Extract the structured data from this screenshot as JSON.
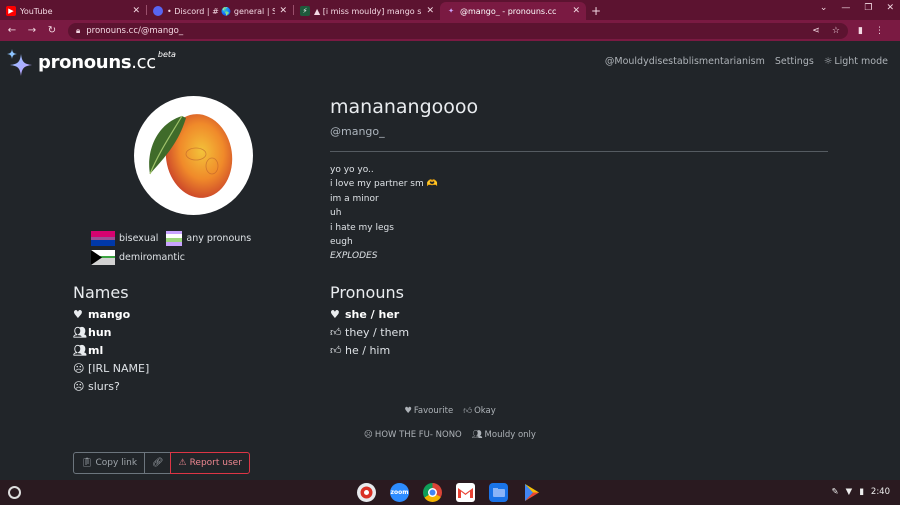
{
  "browser": {
    "tabs": [
      {
        "title": "YouTube",
        "icon": "youtube-icon",
        "color": "#ff0000",
        "active": false
      },
      {
        "title": "• Discord | # 🌎 general | Sou",
        "icon": "discord-icon",
        "color": "#5865f2",
        "active": false
      },
      {
        "title": "▲ [i miss mouldy] mango s",
        "icon": "tab-app-icon",
        "color": "#1e5a3c",
        "active": false
      },
      {
        "title": "@mango_ - pronouns.cc",
        "icon": "pronouns-icon",
        "color": "#b388ff",
        "active": true
      }
    ],
    "url": "pronouns.cc/@mango_"
  },
  "site": {
    "brand": "pronouns",
    "brand_tld": ".cc",
    "beta": "beta",
    "nav": {
      "user": "@Mouldydisestablismentarianism",
      "settings": "Settings",
      "theme": "Light mode"
    }
  },
  "profile": {
    "display_name": "mananangoooo",
    "username": "@mango_",
    "bio": [
      "yo yo yo..",
      "i love my partner sm 🫶",
      "im a minor",
      "uh",
      "i hate my legs",
      "eugh",
      "EXPLODES"
    ],
    "flags": [
      {
        "name": "bisexual"
      },
      {
        "name": "any pronouns"
      },
      {
        "name": "demiromantic"
      }
    ],
    "names_title": "Names",
    "names": [
      {
        "text": "mango",
        "icon": "heart-icon",
        "bold": true
      },
      {
        "text": "hun",
        "icon": "people-icon",
        "bold": true
      },
      {
        "text": "ml",
        "icon": "people-icon",
        "bold": true
      },
      {
        "text": "[IRL NAME]",
        "icon": "frown-icon",
        "bold": false
      },
      {
        "text": "slurs?",
        "icon": "frown-icon",
        "bold": false
      }
    ],
    "pronouns_title": "Pronouns",
    "pronouns": [
      {
        "text": "she / her",
        "icon": "heart-icon",
        "bold": true
      },
      {
        "text": "they / them",
        "icon": "thumbs-up-icon",
        "bold": false
      },
      {
        "text": "he / him",
        "icon": "thumbs-up-icon",
        "bold": false
      }
    ]
  },
  "legend": {
    "row1": [
      {
        "text": "Favourite",
        "icon": "heart-icon"
      },
      {
        "text": "Okay",
        "icon": "thumbs-up-icon"
      }
    ],
    "row2": [
      {
        "text": "HOW THE FU- NONO",
        "icon": "frown-icon"
      },
      {
        "text": "Mouldy only",
        "icon": "people-icon"
      }
    ]
  },
  "actions": {
    "copy_link": "Copy link",
    "report": "Report user"
  },
  "shelf": {
    "time": "2:40",
    "apps": [
      "photos-app",
      "zoom-app",
      "chrome-app",
      "gmail-app",
      "files-app",
      "play-store-app"
    ],
    "zoom_label": "zoom"
  },
  "colors": {
    "background": "#212529",
    "tab_strip": "#5c1330",
    "toolbar": "#7a1a42",
    "danger": "#dc3545"
  }
}
